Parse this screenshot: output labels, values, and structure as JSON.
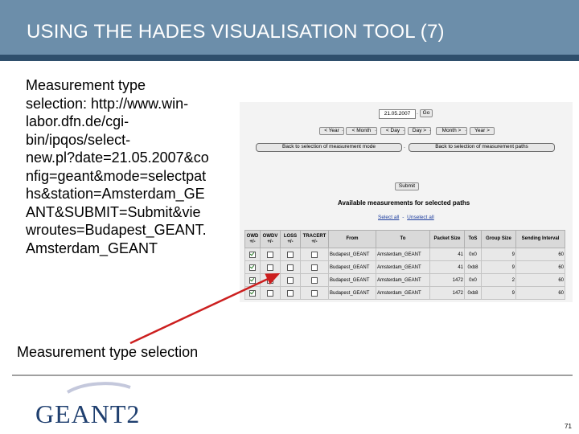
{
  "title": "USING THE HADES VISUALISATION TOOL (7)",
  "description_lines": [
    "Measurement type",
    "selection: http://www.win-",
    "labor.dfn.de/cgi-",
    "bin/ipqos/select-",
    "new.pl?date=21.05.2007&co",
    "nfig=geant&mode=selectpat",
    "hs&station=Amsterdam_GE",
    "ANT&SUBMIT=Submit&vie",
    "wroutes=Budapest_GEANT.",
    "Amsterdam_GEANT"
  ],
  "screenshot": {
    "date_value": "21.05.2007",
    "go_label": "Go",
    "nav_buttons": [
      "< Year",
      "< Month",
      "< Day",
      "Day >",
      "Month >",
      "Year >"
    ],
    "back_mode_label": "Back to selection of measurement mode",
    "back_paths_label": "Back to selection of measurement paths",
    "submit_label": "Submit",
    "available_heading": "Available measurements for selected paths",
    "select_all": "Select all",
    "unselect_all": "Unselect all",
    "select_separator": "-",
    "headers": {
      "owd": "OWD",
      "owdv": "OWDV",
      "loss": "LOSS",
      "tracert": "TRACERT",
      "from": "From",
      "to": "To",
      "packet_size": "Packet Size",
      "tos": "ToS",
      "group_size": "Group Size",
      "sending_interval": "Sending Interval",
      "toggle": "+/-"
    },
    "rows": [
      {
        "owd": true,
        "owdv": false,
        "loss": false,
        "tracert": false,
        "from": "Budapest_GEANT",
        "to": "Amsterdam_GEANT",
        "packet_size": "41",
        "tos": "0x0",
        "group_size": "9",
        "sending_interval": "60"
      },
      {
        "owd": true,
        "owdv": false,
        "loss": false,
        "tracert": false,
        "from": "Budapest_GEANT",
        "to": "Amsterdam_GEANT",
        "packet_size": "41",
        "tos": "0xb8",
        "group_size": "9",
        "sending_interval": "60"
      },
      {
        "owd": true,
        "owdv": false,
        "loss": false,
        "tracert": false,
        "from": "Budapest_GEANT",
        "to": "Amsterdam_GEANT",
        "packet_size": "1472",
        "tos": "0x0",
        "group_size": "2",
        "sending_interval": "60"
      },
      {
        "owd": true,
        "owdv": false,
        "loss": false,
        "tracert": false,
        "from": "Budapest_GEANT",
        "to": "Amsterdam_GEANT",
        "packet_size": "1472",
        "tos": "0xb8",
        "group_size": "9",
        "sending_interval": "60"
      }
    ]
  },
  "caption": "Measurement type selection",
  "logo_text": "GEANT2",
  "page_number": "71",
  "colors": {
    "title_bar": "#6c8eaa",
    "title_stripe": "#2f4f6c",
    "arrow": "#cc1f1f",
    "logo_text": "#1f3f6f"
  }
}
